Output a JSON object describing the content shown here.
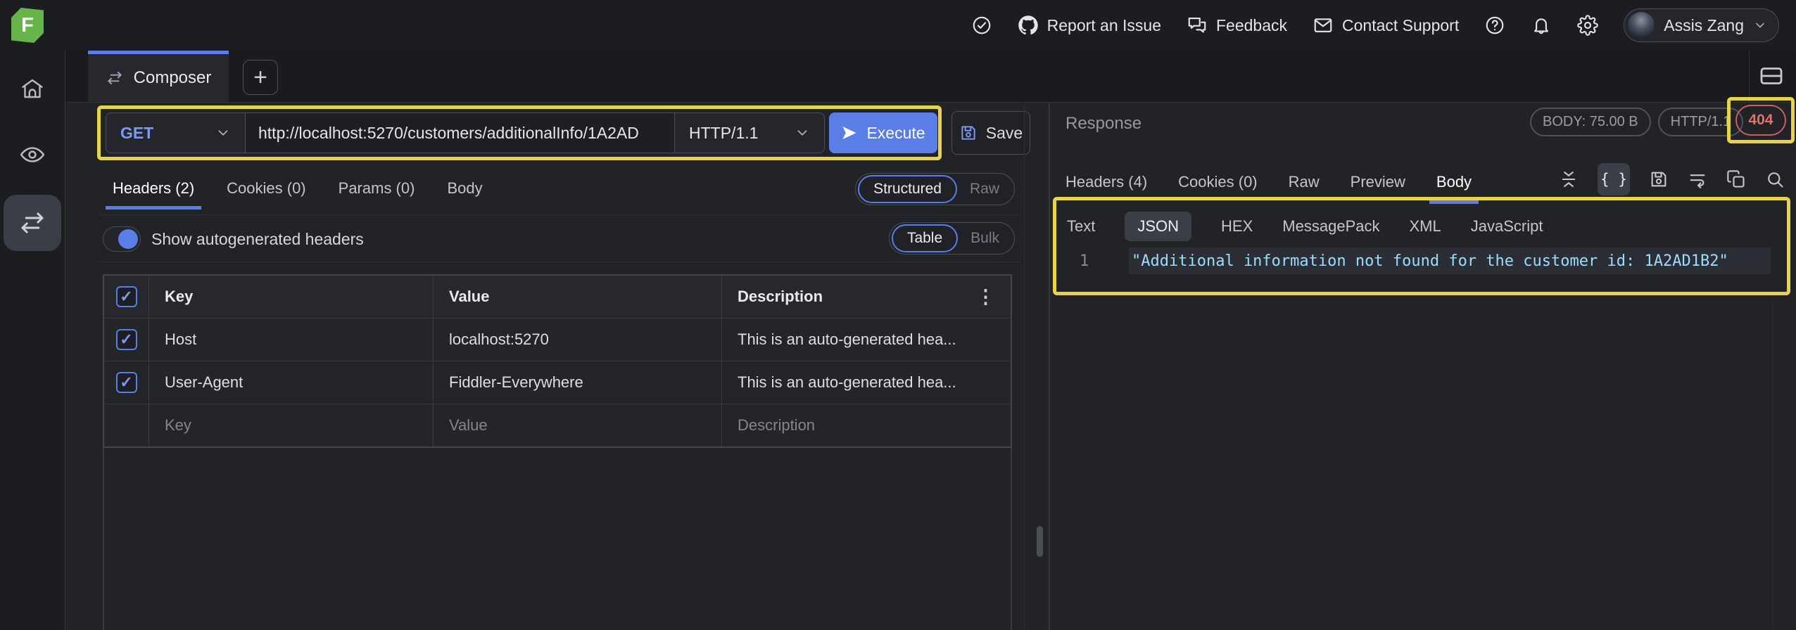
{
  "colors": {
    "accent": "#5a7de6",
    "highlight": "#e8d44a",
    "status_error": "#e0716d",
    "code_text": "#9cdcfe",
    "logo_green": "#67b44a"
  },
  "icons": {
    "logo_letter": "F",
    "plus": "+",
    "check": "✓",
    "kebab": "⋮",
    "braces": "{ }",
    "collapse_handle": "▶"
  },
  "topbar": {
    "report_issue": "Report an Issue",
    "feedback": "Feedback",
    "contact_support": "Contact Support",
    "user_name": "Assis Zang"
  },
  "composer": {
    "tab_title": "Composer",
    "request": {
      "method": "GET",
      "url": "http://localhost:5270/customers/additionalInfo/1A2AD",
      "http_version": "HTTP/1.1",
      "execute_label": "Execute",
      "save_label": "Save"
    },
    "request_tabs": [
      {
        "label": "Headers (2)"
      },
      {
        "label": "Cookies (0)"
      },
      {
        "label": "Params (0)"
      },
      {
        "label": "Body"
      }
    ],
    "view_toggle": {
      "on": "Structured",
      "off": "Raw"
    },
    "autogen_label": "Show autogenerated headers",
    "mode_toggle": {
      "on": "Table",
      "off": "Bulk"
    },
    "table": {
      "col_key": "Key",
      "col_value": "Value",
      "col_desc": "Description",
      "rows": [
        {
          "key": "Host",
          "value": "localhost:5270",
          "description": "This is an auto-generated hea..."
        },
        {
          "key": "User-Agent",
          "value": "Fiddler-Everywhere",
          "description": "This is an auto-generated hea..."
        }
      ],
      "placeholder": {
        "key": "Key",
        "value": "Value",
        "description": "Description"
      }
    }
  },
  "response": {
    "title": "Response",
    "body_size": "BODY: 75.00 B",
    "http_version": "HTTP/1.1",
    "status_code": "404",
    "tabs": [
      {
        "label": "Headers (4)"
      },
      {
        "label": "Cookies (0)"
      },
      {
        "label": "Raw"
      },
      {
        "label": "Preview"
      },
      {
        "label": "Body"
      }
    ],
    "format_tabs": [
      {
        "label": "Text"
      },
      {
        "label": "JSON"
      },
      {
        "label": "HEX"
      },
      {
        "label": "MessagePack"
      },
      {
        "label": "XML"
      },
      {
        "label": "JavaScript"
      }
    ],
    "line_number": "1",
    "body_text": "\"Additional information not found for the customer id: 1A2AD1B2\""
  }
}
